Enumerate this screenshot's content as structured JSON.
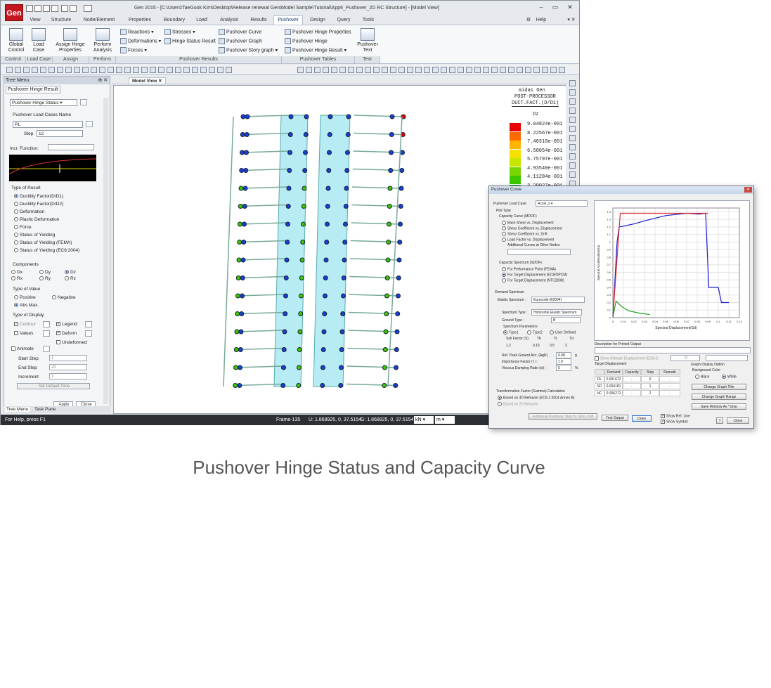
{
  "app": {
    "title": "Gen 2015 - [C:\\Users\\TaeGook Kim\\Desktop\\Release renewal Gen\\Model Sample\\Tutorial\\App6_Pushover_2D RC Structure] - [Model View]",
    "logo": "Gen",
    "help": "Help"
  },
  "menu": [
    "View",
    "Structure",
    "Node/Element",
    "Properties",
    "Boundary",
    "Load",
    "Analysis",
    "Results",
    "Pushover",
    "Design",
    "Query",
    "Tools"
  ],
  "ribbon": {
    "global_control": "Global Control",
    "load_case": "Load Case",
    "assign_hinge": "Assign Hinge Properties",
    "perform": "Perform Analysis",
    "reactions": "Reactions",
    "deformations": "Deformations",
    "forces": "Forces",
    "stresses": "Stresses",
    "hinge_status_result": "Hinge Status Result",
    "pushover_curve": "Pushover Curve",
    "pushover_graph": "Pushover Graph",
    "pushover_story_graph": "Pushover Story graph",
    "pushover_hinge_properties": "Pushover Hinge Properties",
    "pushover_hinge": "Pushover Hinge",
    "pushover_hinge_result": "Pushover Hinge Result",
    "pushover_text": "Pushover Text",
    "groups": [
      "Control",
      "Load Case",
      "Assign",
      "Perform",
      "Pushover Results",
      "Pushover Tables",
      "Text"
    ]
  },
  "tree": {
    "header": "Tree Menu",
    "tab": "Pushover Hinge Result",
    "status_select": "Pushover Hinge Status",
    "load_cases_label": "Pushover Load Cases Name",
    "load_case": "PL",
    "step_label": "Step",
    "step": "12",
    "incr_label": "Incr. Function:",
    "type_of_result": "Type of Result",
    "results": [
      "Ductility Factor(D/D1)",
      "Ductility Factor(D/D2)",
      "Deformation",
      "Plastic Deformation",
      "Force",
      "Status of Yielding",
      "Status of Yielding (FEMA)",
      "Status of Yielding (EC8:2004)"
    ],
    "components_label": "Components",
    "components": [
      "Dx",
      "Dy",
      "Dz",
      "Rx",
      "Ry",
      "Rz"
    ],
    "type_of_value": "Type of Value",
    "values": [
      "Positive",
      "Negative",
      "Abs Max."
    ],
    "type_of_display": "Type of Display",
    "display": [
      "Contour",
      "Legend",
      "Values",
      "Deform",
      "Undeformed"
    ],
    "animate": "Animate",
    "start_step_label": "Start Step",
    "start_step": "1",
    "end_step_label": "End Step",
    "end_step": "20",
    "increment_label": "Increment",
    "increment": "1",
    "set_default": "Set Default Time",
    "apply": "Apply",
    "close": "Close",
    "bottom_tabs": [
      "Tree Menu",
      "Task Pane"
    ]
  },
  "view_tab": "Model View",
  "legend": {
    "title1": "midas Gen",
    "title2": "POST-PROCESSOR",
    "title3": "DUCT.FACT.(D/D1)",
    "comp": "Dz",
    "values": [
      "9.04824e-001",
      "8.22567e-001",
      "7.40310e-001",
      "6.58054e-001",
      "5.75797e-001",
      "4.93540e-001",
      "4.11284e-001",
      "3.29027e-001"
    ],
    "colors": [
      "#e80000",
      "#ff6a00",
      "#ffb400",
      "#f5e000",
      "#c8e600",
      "#7ad400",
      "#3cc800",
      "#00b400"
    ]
  },
  "status": {
    "help": "For Help, press F1",
    "frame": "Frame-135",
    "u": "U: 1.868925, 0, 37.5154",
    "g": "G: 1.868925, 0, 37.5154",
    "unit_force": "kN",
    "unit_len": "m"
  },
  "dialog": {
    "title": "Pushover Curve",
    "load_case_label": "Pushover Load Case",
    "load_case": "Accel_x",
    "plot_type": "Plot Type",
    "capacity_curve": "Capacity Curve (MDOF)",
    "opts1": [
      "Base Shear vs. Displacement",
      "Shear Coefficient vs. Displacement",
      "Shear Coefficient vs. Drift",
      "Load Factor vs. Displacement"
    ],
    "additional": "Additional Curves at Other Nodes",
    "capacity_spectrum": "Capacity Spectrum (SDOF)",
    "opts2": [
      "For Performance Point (FEMA)",
      "For Target Displacement (EC8/OPCM)",
      "For Target Displacement (NTC2008)"
    ],
    "demand_spectrum": "Demand Spectrum",
    "elastic_label": "Elastic Spectrum :",
    "elastic": "Eurocode-8(2004)",
    "spectrum_type_label": "Spectrum Type :",
    "spectrum_type": "Horizontal Elastic Spectrum",
    "ground_type_label": "Ground Type :",
    "ground_type": "B",
    "spectrum_params": "Spectrum Parameters",
    "types": [
      "Type1",
      "Type2",
      "User Defined"
    ],
    "soil_headers": [
      "Soil Factor (S)",
      "Tb",
      "Tc",
      "Td"
    ],
    "soil_values": [
      "1.2",
      "0.15",
      "0.5",
      "2"
    ],
    "ref_peak_label": "Ref. Peak Ground Acc. (AgR)",
    "ref_peak": "0.08",
    "ref_unit": "g",
    "importance_label": "Importance Factor ( I ):",
    "importance": "1.0",
    "damping_label": "Viscous Damping Ratio (xi) :",
    "damping": "5",
    "damping_unit": "%",
    "transformation": "Transformation Factor (Gamma) Calculation",
    "opts3": [
      "Based on 3D Behavior (EC8-1:2004 Annex B)",
      "Based on 2D Behavior"
    ],
    "additional_step": "Additional Pushover Step for Story Drift",
    "desc_label": "Description for Printed Output",
    "show_ultimate": "Show Ultimate Displacement (EC8-3)",
    "ultimate_value": "0",
    "target_disp": "Target Displacement",
    "table_headers": [
      "",
      "Demand",
      "Capacity",
      "Step",
      "Remark"
    ],
    "table_rows": [
      [
        "DL",
        "0.001672",
        "-",
        "0",
        "-"
      ],
      [
        "SD",
        "0.004181",
        "-",
        "1",
        "-"
      ],
      [
        "NC",
        "0.006272",
        "-",
        "2",
        "-"
      ]
    ],
    "graph_display": "Graph Display Option",
    "bg_color": "Background Color",
    "bg_opts": [
      "Black",
      "White"
    ],
    "btns": [
      "Change Graph Title",
      "Change Graph Range",
      "Save Window As *.bmp"
    ],
    "text_output": "Text Output",
    "draw": "Draw",
    "show_ref_line": "Show Ref. Line",
    "show_symbol": "Show Symbol",
    "close": "Close",
    "x_axis_label": "Spectral Displacement(Sd)",
    "y_axis_label": "Spectral Acceleration(Sa)",
    "x_ticks": [
      "0",
      "0.01",
      "0.02",
      "0.03",
      "0.04",
      "0.05",
      "0.06",
      "0.07",
      "0.08",
      "0.09",
      "0.1",
      "0.11",
      "0.12"
    ],
    "y_ticks": [
      "0",
      "0.1",
      "0.2",
      "0.3",
      "0.4",
      "0.5",
      "0.6",
      "0.7",
      "0.8",
      "0.9",
      "1",
      "1.1",
      "1.2",
      "1.3",
      "1.4"
    ]
  },
  "chart_data": {
    "type": "line",
    "xlabel": "Spectral Displacement(Sd)",
    "ylabel": "Spectral Acceleration(Sa)",
    "xlim": [
      0,
      0.12
    ],
    "ylim": [
      0,
      1.45
    ],
    "series": [
      {
        "color": "#1c1cd6",
        "points": [
          [
            0,
            0
          ],
          [
            0.004,
            1.0
          ],
          [
            0.006,
            1.2
          ],
          [
            0.01,
            1.21
          ],
          [
            0.02,
            1.24
          ],
          [
            0.03,
            1.28
          ],
          [
            0.05,
            1.35
          ],
          [
            0.07,
            1.38
          ],
          [
            0.082,
            1.37
          ],
          [
            0.088,
            1.38
          ],
          [
            0.091,
            0.4
          ],
          [
            0.1,
            0.4
          ],
          [
            0.103,
            0.2
          ],
          [
            0.11,
            0.2
          ]
        ]
      },
      {
        "color": "#e03030",
        "points": [
          [
            0,
            0
          ],
          [
            0.007,
            1.38
          ],
          [
            0.09,
            1.38
          ]
        ]
      },
      {
        "color": "#20a020",
        "points": [
          [
            0,
            0
          ],
          [
            0.003,
            0.22
          ],
          [
            0.008,
            0.15
          ],
          [
            0.015,
            0.09
          ],
          [
            0.025,
            0.06
          ],
          [
            0.035,
            0.04
          ]
        ]
      }
    ]
  },
  "caption": "Pushover Hinge Status and Capacity Curve"
}
